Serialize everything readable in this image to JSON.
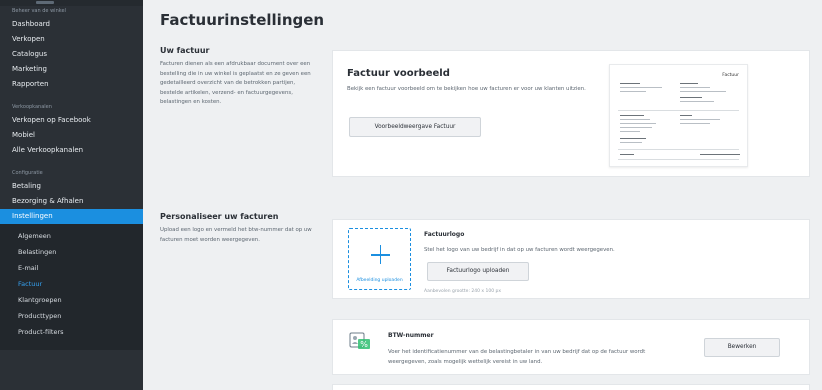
{
  "sidebar": {
    "section_store": "Beheer van de winkel",
    "store_items": [
      "Dashboard",
      "Verkopen",
      "Catalogus",
      "Marketing",
      "Rapporten"
    ],
    "section_channels": "Verkoopkanalen",
    "channel_items": [
      "Verkopen op Facebook",
      "Mobiel",
      "Alle Verkoopkanalen"
    ],
    "section_config": "Configuratie",
    "config_items": [
      "Betaling",
      "Bezorging & Afhalen",
      "Instellingen"
    ],
    "settings_sub": [
      "Algemeen",
      "Belastingen",
      "E-mail",
      "Factuur",
      "Klantgroepen",
      "Producttypen",
      "Product-filters"
    ]
  },
  "page": {
    "title": "Factuurinstellingen"
  },
  "invoice_section": {
    "title": "Uw factuur",
    "description": "Facturen dienen als een afdrukbaar document over een bestelling die in uw winkel is geplaatst en ze geven een gedetailleerd overzicht van de betrokken partijen, bestelde artikelen, verzend- en factuurgegevens, belastingen en kosten."
  },
  "preview_card": {
    "title": "Factuur voorbeeld",
    "description": "Bekijk een factuur voorbeeld om te bekijken hoe uw facturen er voor uw klanten uitzien.",
    "button": "Voorbeeldweergave Factuur",
    "thumbnail_title": "Factuur"
  },
  "personalize_section": {
    "title": "Personaliseer uw facturen",
    "description": "Upload een logo en vermeld het btw-nummer dat op uw facturen moet worden weergegeven."
  },
  "logo_card": {
    "upload_caption": "Afbeelding uploaden",
    "title": "Factuurlogo",
    "description": "Stel het logo van uw bedrijf in dat op uw facturen wordt weergegeven.",
    "button": "Factuurlogo uploaden",
    "hint": "Aanbevolen grootte: 240 x 100 px"
  },
  "vat_card": {
    "title": "BTW-nummer",
    "description": "Voer het identificatienummer van de belastingbetaler in van uw bedrijf dat op de factuur wordt weergegeven, zoals mogelijk wettelijk vereist in uw land.",
    "button": "Bewerken"
  },
  "colors": {
    "accent": "#1b8fe0",
    "sidebar_bg": "#2b3036",
    "page_bg": "#eef0f2"
  }
}
